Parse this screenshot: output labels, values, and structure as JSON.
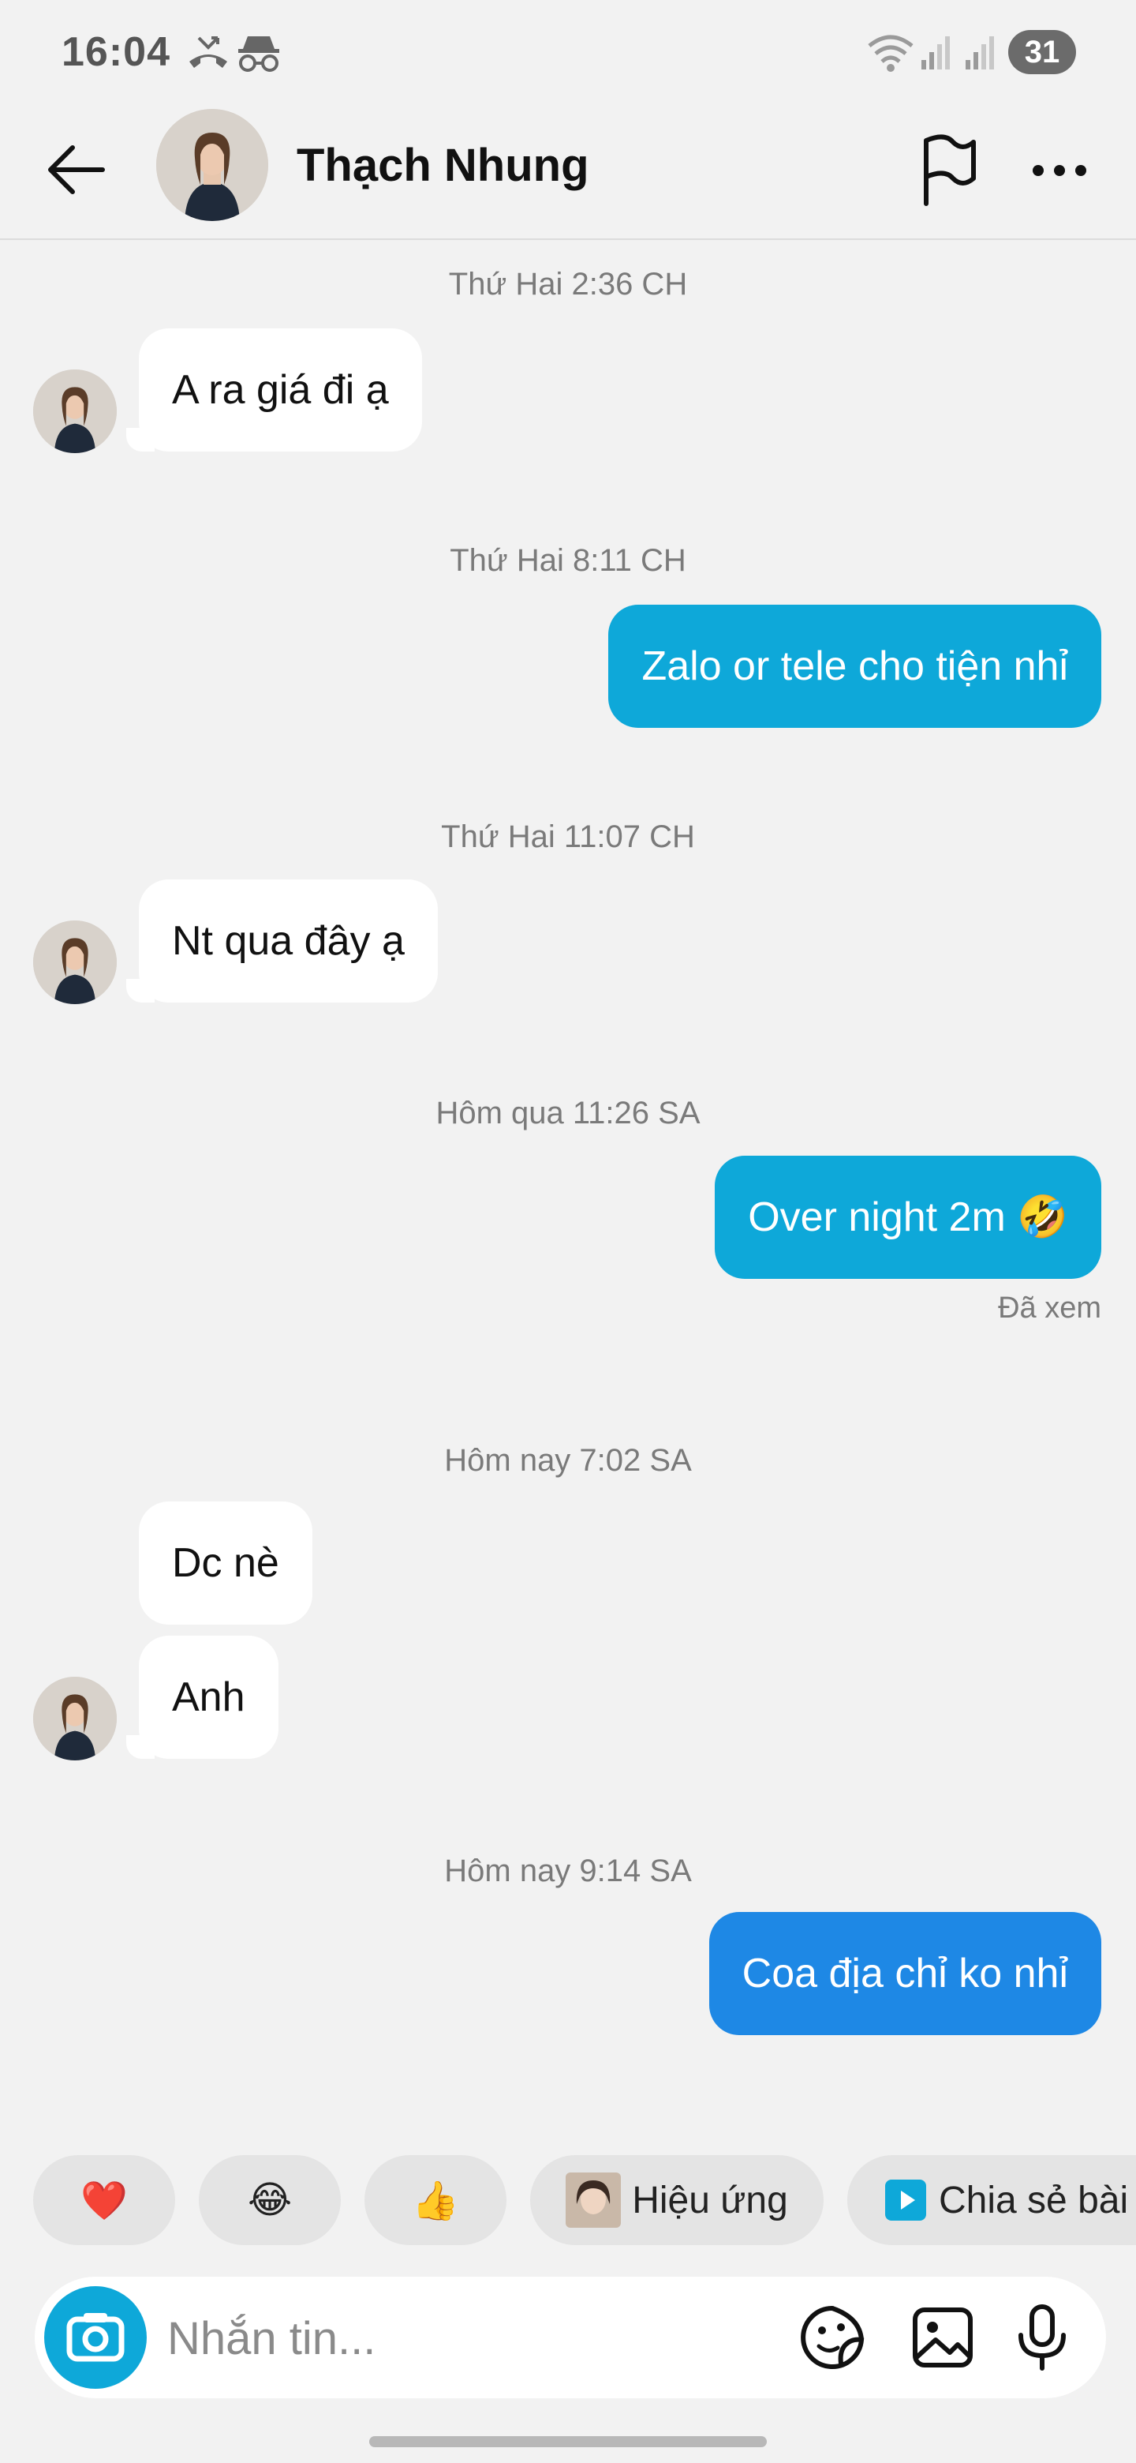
{
  "status_bar": {
    "time": "16:04",
    "battery": "31",
    "icons": [
      "missed-call-icon",
      "incognito-icon",
      "wifi-icon",
      "signal-icon",
      "signal-icon"
    ]
  },
  "header": {
    "contact_name": "Thạch Nhung",
    "icons": [
      "back-arrow-icon",
      "flag-icon",
      "more-icon"
    ]
  },
  "messages": {
    "ts1": "Thứ Hai 2:36 CH",
    "m1": "A ra giá đi ạ",
    "ts2": "Thứ Hai 8:11 CH",
    "m2": "Zalo or tele cho tiện nhỉ",
    "ts3": "Thứ Hai 11:07 CH",
    "m3": "Nt qua đây ạ",
    "ts4": "Hôm qua 11:26 SA",
    "m4": "Over night 2m 🤣",
    "seen": "Đã xem",
    "ts5": "Hôm nay 7:02 SA",
    "m5": "Dc nè",
    "m6": "Anh",
    "ts6": "Hôm nay 9:14 SA",
    "m7": "Coa địa chỉ ko nhỉ"
  },
  "quick_actions": {
    "heart": "❤️",
    "laugh": "😂",
    "thumbs": "👍",
    "effects": "Hiệu ứng",
    "share": "Chia sẻ bài"
  },
  "composer": {
    "placeholder": "Nhắn tin...",
    "value": ""
  },
  "colors": {
    "outgoing": "#0ea8d9",
    "outgoing_last": "#1e88e5",
    "incoming": "#ffffff",
    "background": "#f2f2f2"
  }
}
